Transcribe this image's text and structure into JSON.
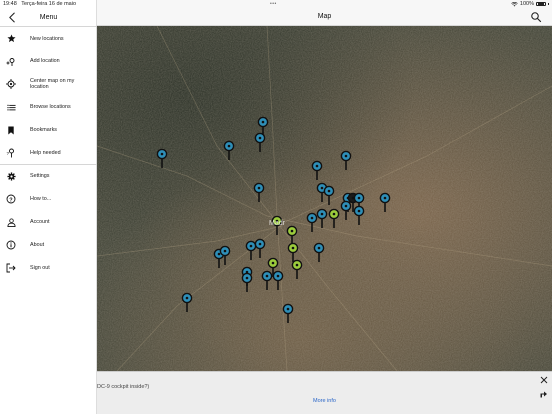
{
  "status_bar": {
    "time": "19:48",
    "date": "Terça-feira 16 de maio",
    "battery_percent": "100%"
  },
  "nav": {
    "title": "Map"
  },
  "menu": {
    "title": "Menu",
    "items_primary": [
      {
        "label": "New locations",
        "icon": "star-icon"
      },
      {
        "label": "Add location",
        "icon": "add-location-icon"
      },
      {
        "label": "Center map on my location",
        "icon": "crosshair-icon"
      },
      {
        "label": "Browse locations",
        "icon": "list-icon"
      },
      {
        "label": "Bookmarks",
        "icon": "bookmark-icon"
      },
      {
        "label": "Help needed",
        "icon": "help-pin-icon"
      }
    ],
    "items_secondary": [
      {
        "label": "Settings",
        "icon": "gear-icon"
      },
      {
        "label": "How to...",
        "icon": "question-icon"
      },
      {
        "label": "Account",
        "icon": "person-icon"
      },
      {
        "label": "About",
        "icon": "info-icon"
      },
      {
        "label": "Sign out",
        "icon": "sign-out-icon"
      }
    ]
  },
  "map": {
    "city_label": "Madr",
    "pin_colors": {
      "blue": "#2e8fb8",
      "green": "#9ccc3c",
      "dark": "#1b1b1b"
    }
  },
  "bottom_panel": {
    "caption": "DC-9 cockpit inside?)",
    "more_info": "More info"
  },
  "colors": {
    "link": "#2a66c8",
    "menu_bg": "#ffffff",
    "nav_bg": "#f7f7f7"
  }
}
